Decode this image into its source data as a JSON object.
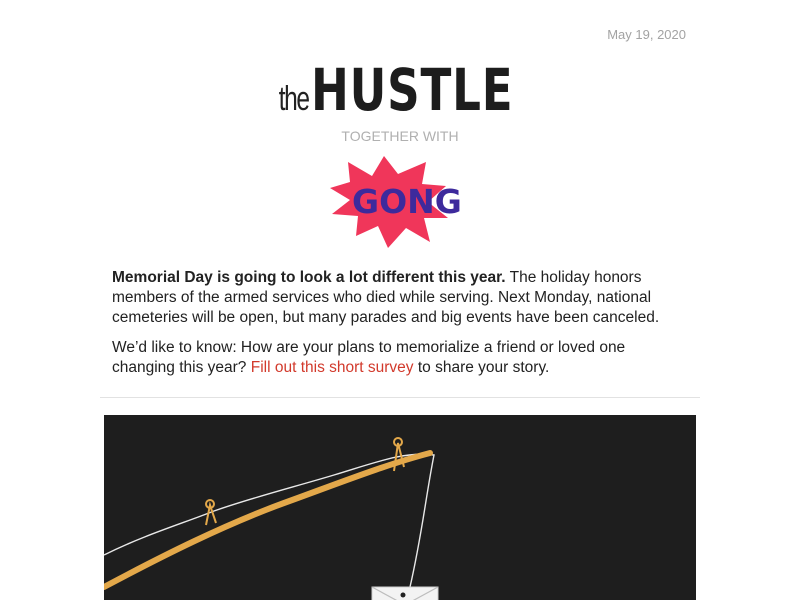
{
  "email": {
    "date": "May 19, 2020",
    "logo": {
      "the": "the",
      "hustle": "HUSTLE"
    },
    "together_with": "TOGETHER WITH",
    "sponsor": {
      "name": "GONG",
      "colors": {
        "burst": "#f0365a",
        "text": "#3d2a9c"
      }
    },
    "intro": {
      "headline": "Memorial Day is going to look a lot different this year.",
      "body": " The holiday honors members of the armed services who died while serving. Next Monday, national cemeteries will be open, but many parades and big events have been canceled.",
      "question_before": "We’d like to know: How are your plans to memorialize a friend or loved one changing this year? ",
      "survey_link": "Fill out this short survey",
      "question_after": " to share your story."
    },
    "colors": {
      "link": "#d23a2c",
      "hero_bg": "#1e1e1e",
      "rod": "#e3a84a"
    }
  }
}
